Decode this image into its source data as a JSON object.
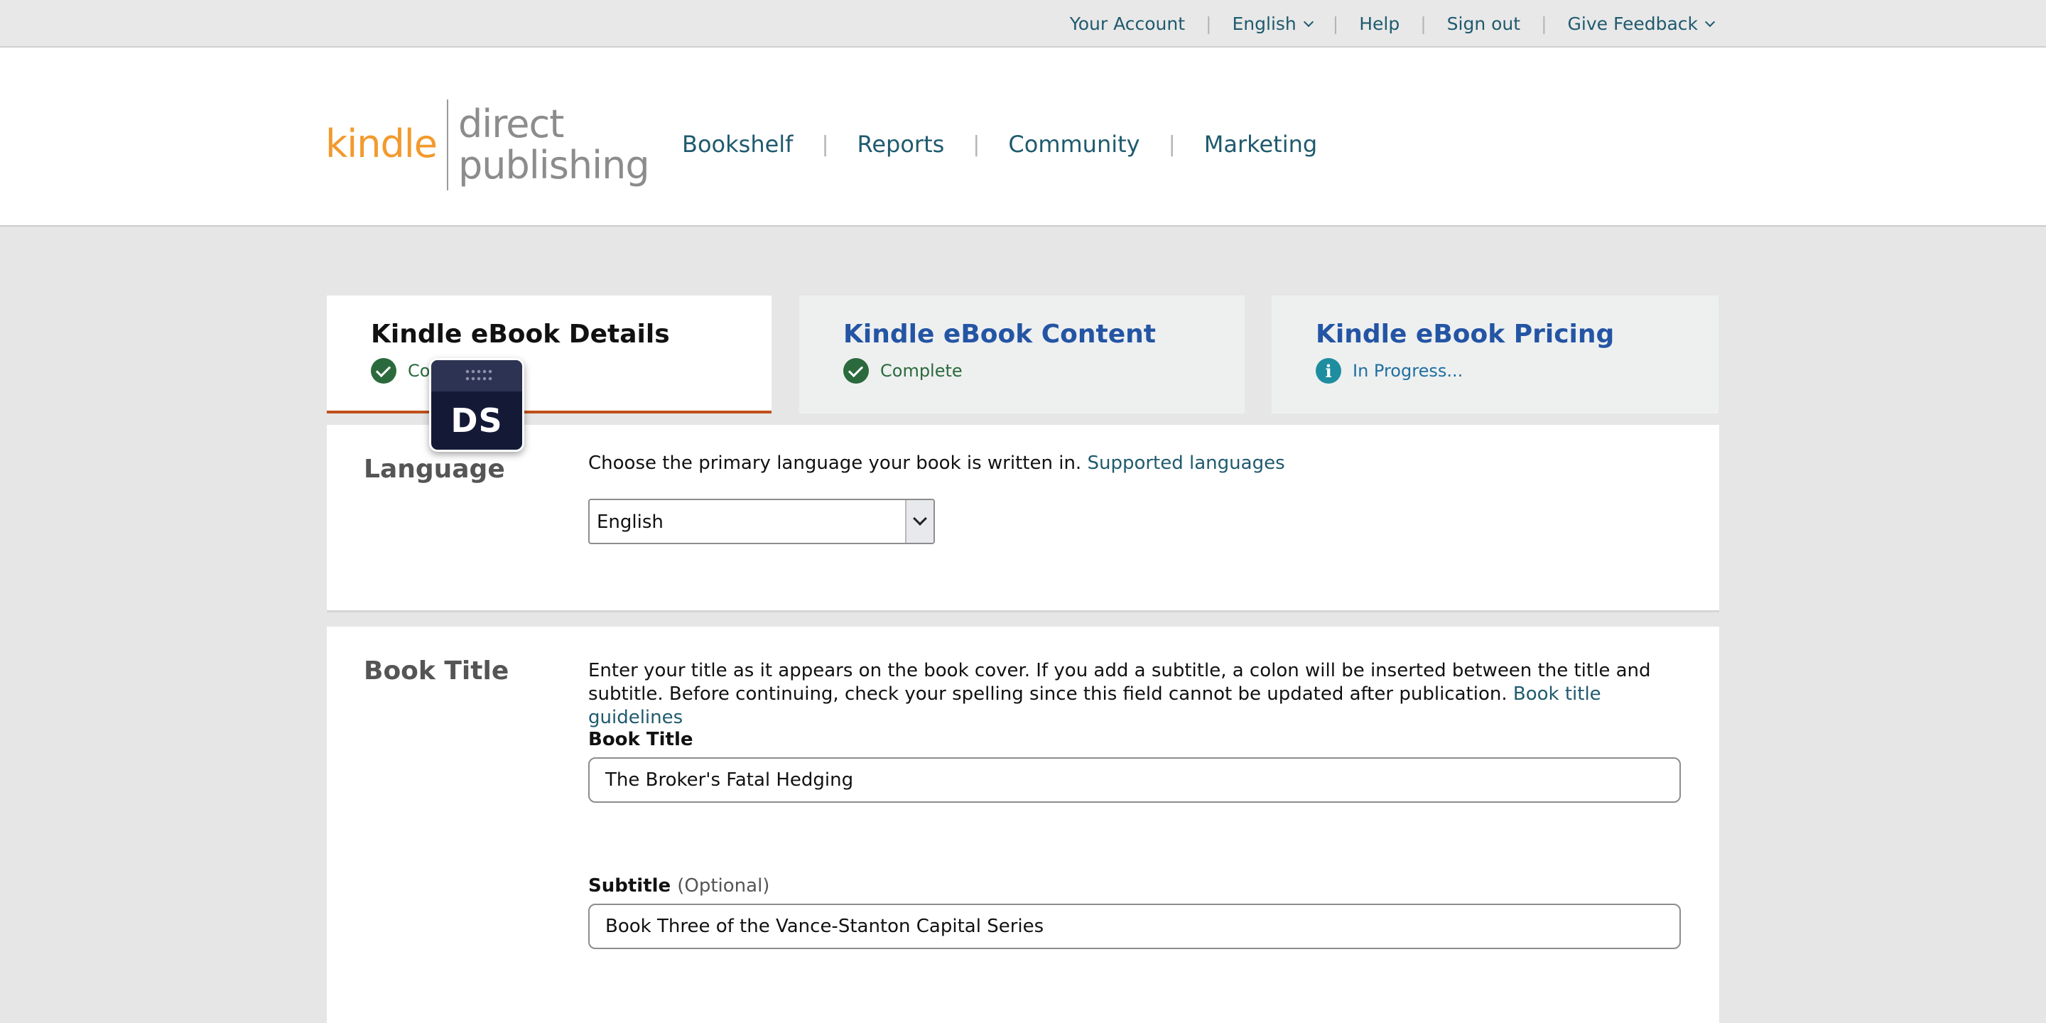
{
  "topbar": {
    "items": [
      {
        "label": "Your Account"
      },
      {
        "label": "English"
      },
      {
        "label": "Help"
      },
      {
        "label": "Sign out"
      },
      {
        "label": "Give Feedback"
      }
    ],
    "separator": "|"
  },
  "header": {
    "logo": {
      "kindle": "kindle",
      "direct": "direct",
      "publishing": "publishing"
    },
    "nav": [
      {
        "label": "Bookshelf"
      },
      {
        "label": "Reports"
      },
      {
        "label": "Community"
      },
      {
        "label": "Marketing"
      }
    ]
  },
  "tabs": [
    {
      "title": "Kindle eBook Details",
      "status": "Complete",
      "state": "active"
    },
    {
      "title": "Kindle eBook Content",
      "status": "Complete",
      "state": "inactive"
    },
    {
      "title": "Kindle eBook Pricing",
      "status": "In Progress...",
      "state": "inactive"
    }
  ],
  "language_section": {
    "label": "Language",
    "help": "Choose the primary language your book is written in.",
    "help_link": "Supported languages",
    "selected": "English"
  },
  "title_section": {
    "label": "Book Title",
    "help": "Enter your title as it appears on the book cover. If you add a subtitle, a colon will be inserted between the title and subtitle. Before continuing, check your spelling since this field cannot be updated after publication.",
    "help_link": "Book title guidelines",
    "title_field_label": "Book Title",
    "title_value": "The Broker's Fatal Hedging",
    "subtitle_field_label": "Subtitle",
    "subtitle_optional": "(Optional)",
    "subtitle_value": "Book Three of the Vance-Stanton Capital Series"
  },
  "widget": {
    "text": "DS"
  },
  "colors": {
    "link": "#1f5a6e",
    "tab_link": "#2455a4",
    "active_tab_underline": "#c0501b",
    "complete_green": "#2b6a3c",
    "info_teal": "#1f8da0",
    "kindle_orange": "#f29a2e"
  }
}
